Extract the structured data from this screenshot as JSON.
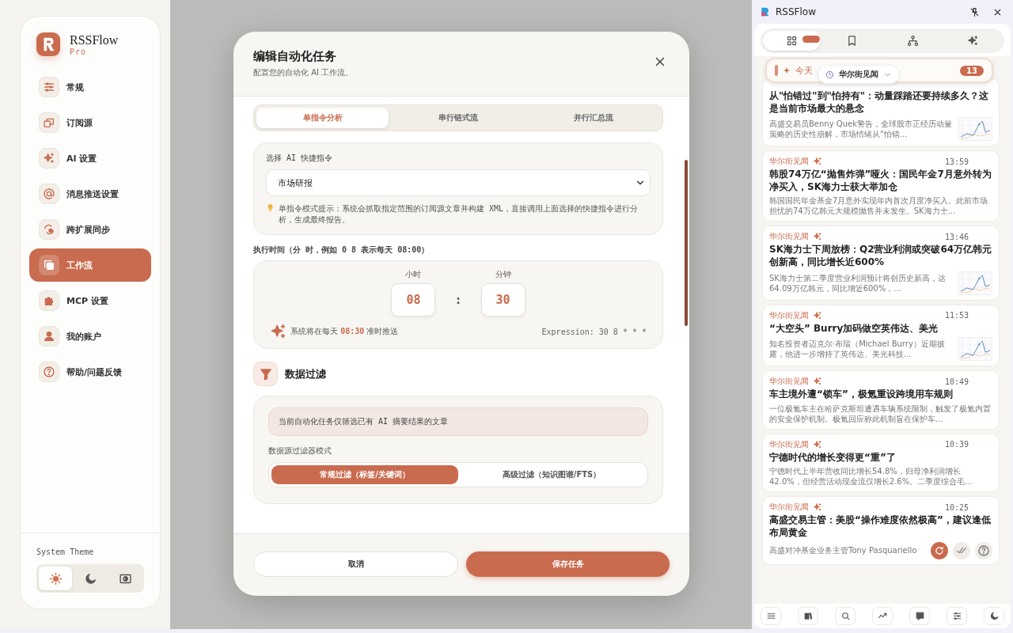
{
  "sidebar": {
    "app_name": "RSSFlow",
    "edition": "Pro",
    "items": [
      {
        "label": "常规",
        "selected": false
      },
      {
        "label": "订阅源",
        "selected": false
      },
      {
        "label": "AI 设置",
        "selected": false
      },
      {
        "label": "消息推送设置",
        "selected": false
      },
      {
        "label": "跨扩展同步",
        "selected": false
      },
      {
        "label": "工作流",
        "selected": true
      },
      {
        "label": "MCP 设置",
        "selected": false
      },
      {
        "label": "我的账户",
        "selected": false
      },
      {
        "label": "帮助/问题反馈",
        "selected": false
      }
    ],
    "theme_label": "System Theme",
    "themes": [
      {
        "selected": true
      },
      {
        "selected": false
      },
      {
        "selected": false
      }
    ]
  },
  "modal": {
    "title": "编辑自动化任务",
    "subtitle": "配置您的自动化 AI 工作流。",
    "mode_tabs": [
      {
        "label": "单指令分析",
        "selected": true
      },
      {
        "label": "串行链式流",
        "selected": false
      },
      {
        "label": "并行汇总流",
        "selected": false
      }
    ],
    "command": {
      "label": "选择 AI 快捷指令",
      "value": "市场研报",
      "hint": "单指令模式提示：系统会抓取指定范围的订阅源文章并构建 XML，直接调用上面选择的快捷指令进行分析，生成最终报告。"
    },
    "schedule": {
      "label": "执行时间（分 时，例如 0 8 表示每天 08:00）",
      "hour_label": "小时",
      "hour": "08",
      "separator": ":",
      "minute_label": "分钟",
      "minute": "30",
      "summary_before": "系统将在每天",
      "summary_time": "08:30",
      "summary_after": "准时推送",
      "expression": "Expression: 30 8 * * *"
    },
    "filter": {
      "title": "数据过滤",
      "notice": "当前自动化任务仅筛选已有 AI 摘要结果的文章",
      "mode_label": "数据源过滤器模式",
      "modes": [
        {
          "label": "常规过滤（标签/关键词）",
          "selected": true
        },
        {
          "label": "高级过滤（知识图谱/FTS）",
          "selected": false
        }
      ]
    },
    "cancel": "取消",
    "save": "保存任务"
  },
  "panel": {
    "title": "RSSFlow",
    "tabs": [
      {
        "selected": true
      },
      {
        "selected": false
      },
      {
        "selected": false
      },
      {
        "selected": false
      }
    ],
    "today": {
      "label": "今天",
      "source": "华尔街见闻",
      "count": "13"
    },
    "articles": [
      {
        "title": "从\"怕错过\"到\"怕持有\"：动量踩踏还要持续多久？这是当前市场最大的悬念",
        "summary": "高盛交易员Benny Quek警告，全球股市正经历动量策略的历史性崩解，市场情绪从\"怕错...",
        "thumbnail": true
      },
      {
        "source": "华尔街见闻",
        "time": "13:59",
        "title": "韩股74万亿“抛售炸弹”哑火：国民年金7月意外转为净买入，SK海力士获大举加仓",
        "summary": "韩国国民年金基金7月意外实现年内首次月度净买入。此前市场担忧的74万亿韩元大规模抛售并未发生。SK海力士...",
        "thumbnail": false
      },
      {
        "source": "华尔街见闻",
        "time": "13:46",
        "title": "SK海力士下周放榜：Q2营业利润或突破64万亿韩元创新高，同比增长近600%",
        "summary": "SK海力士第二季度营业利润预计将创历史新高，达64.09万亿韩元，同比增近600%，...",
        "thumbnail": true
      },
      {
        "source": "华尔街见闻",
        "time": "11:53",
        "title": "“大空头” Burry加码做空英伟达、美光",
        "summary": "知名投资者迈克尔·布瑞（Michael Burry）近期披露，他进一步增持了英伟达、美光科技...",
        "thumbnail": true
      },
      {
        "source": "华尔街见闻",
        "time": "10:49",
        "title": "车主境外遭“锁车”，极氪重设跨境用车规则",
        "summary": "一位极氪车主在哈萨克斯坦遭遇车辆系统限制，触发了极氪内置的安全保护机制。极氪回应称此机制旨在保护车...",
        "thumbnail": false
      },
      {
        "source": "华尔街见闻",
        "time": "10:39",
        "title": "宁德时代的增长变得更“重”了",
        "summary": "宁德时代上半年营收同比增长54.8%，归母净利润增长42.0%，但经营活动现金流仅增长2.6%。二季度综合毛...",
        "thumbnail": false
      },
      {
        "source": "华尔街见闻",
        "time": "10:25",
        "title": "高盛交易主管：美股“操作难度依然极高”，建议逢低布局黄金",
        "summary": "高盛对冲基金业务主管Tony Pasquariello",
        "thumbnail": false
      }
    ]
  }
}
